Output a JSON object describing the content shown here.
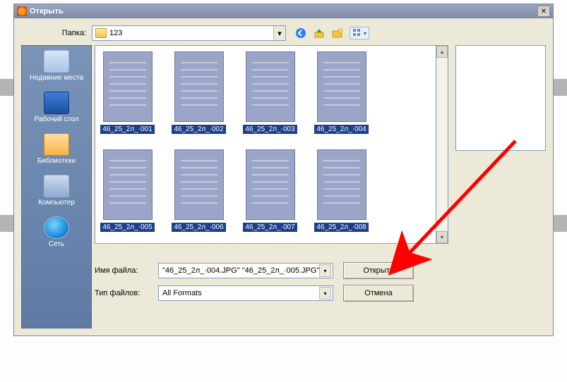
{
  "window": {
    "title": "Открыть"
  },
  "toolbar": {
    "folder_label": "Папка:",
    "folder_value": "123"
  },
  "sidebar": {
    "items": [
      {
        "label": "Недавние места"
      },
      {
        "label": "Рабочий стол"
      },
      {
        "label": "Библиотеки"
      },
      {
        "label": "Компьютер"
      },
      {
        "label": "Сеть"
      }
    ]
  },
  "files": [
    {
      "caption": "46_25_2л_·001",
      "selected": true
    },
    {
      "caption": "46_25_2л_·002",
      "selected": true
    },
    {
      "caption": "46_25_2л_·003",
      "selected": true
    },
    {
      "caption": "46_25_2л_·004",
      "selected": true
    },
    {
      "caption": "46_25_2л_·005",
      "selected": true
    },
    {
      "caption": "46_25_2л_·006",
      "selected": true
    },
    {
      "caption": "46_25_2л_·007",
      "selected": true
    },
    {
      "caption": "46_25_2л_·008",
      "selected": true
    }
  ],
  "fields": {
    "filename_label": "Имя файла:",
    "filename_value": "\"46_25_2л_·004.JPG\" \"46_25_2л_·005.JPG\"",
    "filetype_label": "Тип файлов:",
    "filetype_value": "All Formats"
  },
  "buttons": {
    "open": "Открыть",
    "cancel": "Отмена"
  },
  "icons": {
    "back": "back-icon",
    "up": "up-icon",
    "new_folder": "new-folder-icon",
    "view_menu": "view-menu-icon"
  },
  "annotation": {
    "arrow_color": "#ff0000"
  }
}
